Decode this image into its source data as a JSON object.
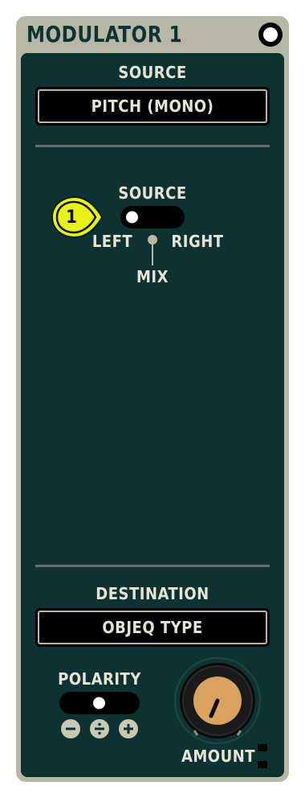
{
  "module": {
    "title": "MODULATOR 1",
    "power_on": true
  },
  "source_section": {
    "label": "SOURCE",
    "selected": "PITCH (MONO)"
  },
  "input_switch": {
    "label": "SOURCE",
    "left_label": "LEFT",
    "right_label": "RIGHT",
    "mix_label": "MIX",
    "position": "left"
  },
  "badge": {
    "number": "1",
    "color": "#e6f21a"
  },
  "destination_section": {
    "label": "DESTINATION",
    "selected": "OBJEQ TYPE"
  },
  "polarity": {
    "label": "POLARITY",
    "position": "center",
    "icons": [
      "minus-icon",
      "divide-icon",
      "plus-icon"
    ]
  },
  "amount": {
    "label": "AMOUNT",
    "knob_color": "#d9a25e"
  },
  "colors": {
    "frame": "#b8b7a6",
    "panel": "#0e3231",
    "text": "#e6e4d3",
    "accent_badge": "#e6f21a"
  }
}
